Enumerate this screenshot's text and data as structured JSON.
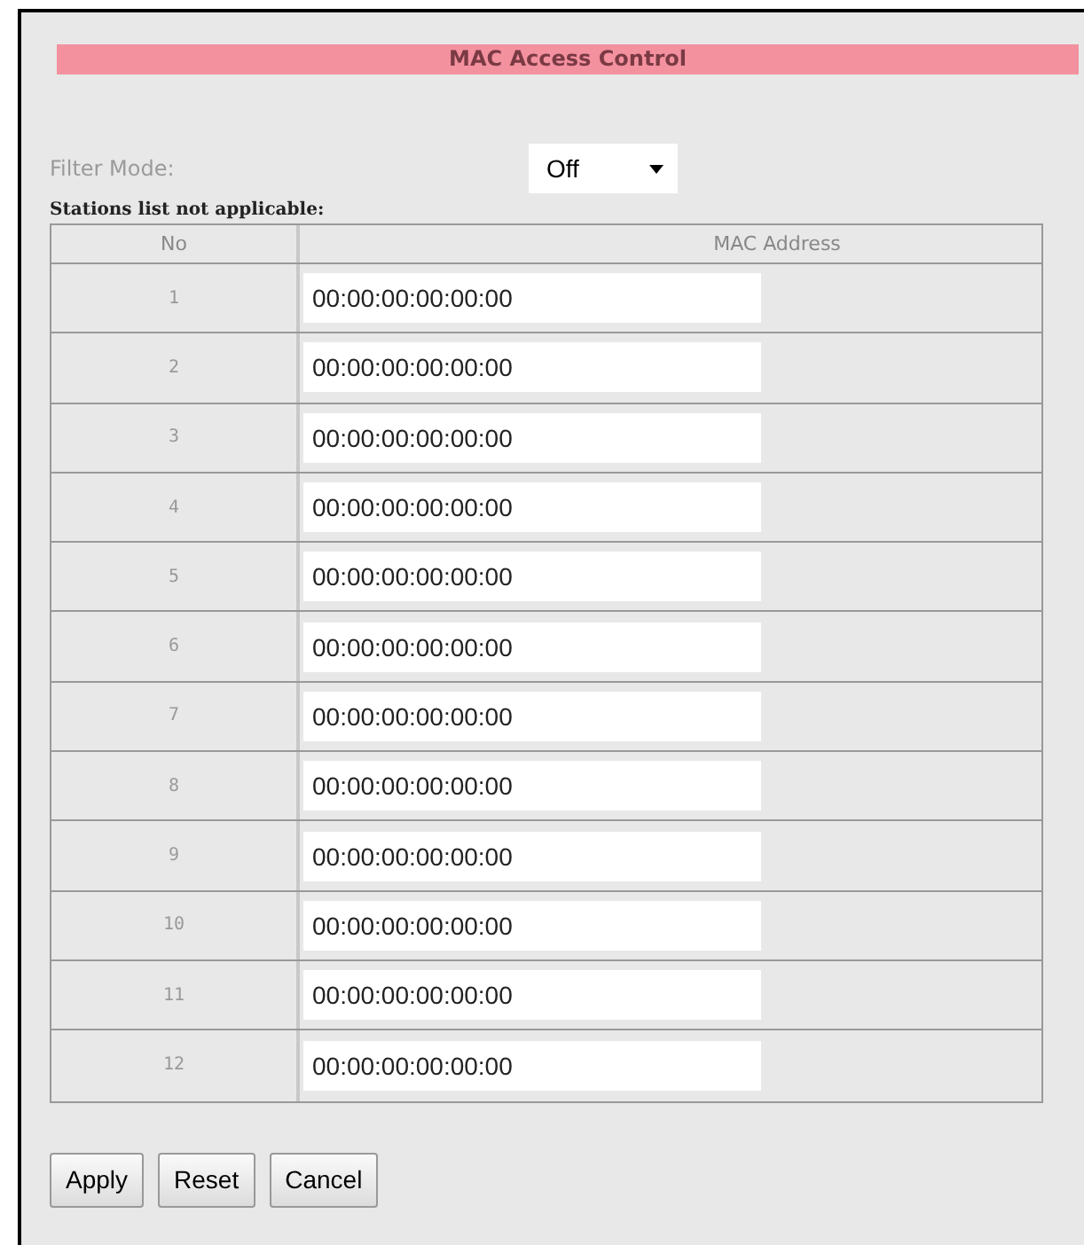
{
  "title": "MAC Access Control",
  "filter_mode": {
    "label": "Filter Mode:",
    "value": "Off"
  },
  "stations_note": "Stations list not applicable:",
  "table": {
    "columns": [
      "No",
      "MAC Address"
    ],
    "rows": [
      {
        "no": "1",
        "mac": "00:00:00:00:00:00"
      },
      {
        "no": "2",
        "mac": "00:00:00:00:00:00"
      },
      {
        "no": "3",
        "mac": "00:00:00:00:00:00"
      },
      {
        "no": "4",
        "mac": "00:00:00:00:00:00"
      },
      {
        "no": "5",
        "mac": "00:00:00:00:00:00"
      },
      {
        "no": "6",
        "mac": "00:00:00:00:00:00"
      },
      {
        "no": "7",
        "mac": "00:00:00:00:00:00"
      },
      {
        "no": "8",
        "mac": "00:00:00:00:00:00"
      },
      {
        "no": "9",
        "mac": "00:00:00:00:00:00"
      },
      {
        "no": "10",
        "mac": "00:00:00:00:00:00"
      },
      {
        "no": "11",
        "mac": "00:00:00:00:00:00"
      },
      {
        "no": "12",
        "mac": "00:00:00:00:00:00"
      }
    ]
  },
  "buttons": [
    "Apply",
    "Reset",
    "Cancel"
  ]
}
